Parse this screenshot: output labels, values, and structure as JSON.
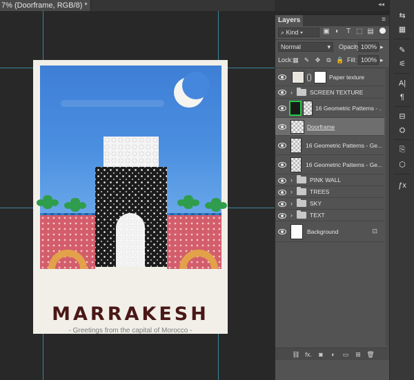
{
  "document_tab": {
    "title": "7% (Doorframe, RGB/8) *"
  },
  "poster": {
    "title": "MARRAKESH",
    "subtitle": "- Greetings from the capital of Morocco -"
  },
  "layers_panel": {
    "tab_label": "Layers",
    "menu_icon": "panel-menu-icon",
    "filter": {
      "kind_label": "Kind",
      "icons": [
        "image-filter-icon",
        "adjustment-filter-icon",
        "type-filter-icon",
        "shape-filter-icon",
        "smart-object-filter-icon"
      ]
    },
    "blend_mode": "Normal",
    "opacity_label": "Opacity:",
    "opacity_value": "100%",
    "lock_label": "Lock:",
    "fill_label": "Fill:",
    "fill_value": "100%",
    "layers": [
      {
        "name": "Paper texture",
        "type": "masked"
      },
      {
        "name": "SCREEN TEXTURE",
        "type": "group"
      },
      {
        "name": "16 Geometric Patterns - ...",
        "type": "clipped-smart"
      },
      {
        "name": "Doorframe",
        "type": "smart",
        "selected": true
      },
      {
        "name": "16 Geometric Patterns - Ge...",
        "type": "smart"
      },
      {
        "name": "16 Geometric Patterns - Ge...",
        "type": "smart"
      },
      {
        "name": "PINK WALL",
        "type": "group"
      },
      {
        "name": "TREES",
        "type": "group"
      },
      {
        "name": "SKY",
        "type": "group"
      },
      {
        "name": "TEXT",
        "type": "group"
      },
      {
        "name": "Background",
        "type": "background"
      }
    ],
    "footer_icons": [
      "link-layers-icon",
      "fx-icon",
      "add-mask-icon",
      "adjustment-layer-icon",
      "new-group-icon",
      "new-layer-icon",
      "trash-icon"
    ],
    "footer_glyphs": {
      "fx": "fx."
    }
  },
  "colors": {
    "sky": "#4587dc",
    "wall": "#d35d6a",
    "tree": "#2f9d4c",
    "title": "#4a1717",
    "panel": "#535353",
    "selected_layer": "#6e6e6e"
  }
}
